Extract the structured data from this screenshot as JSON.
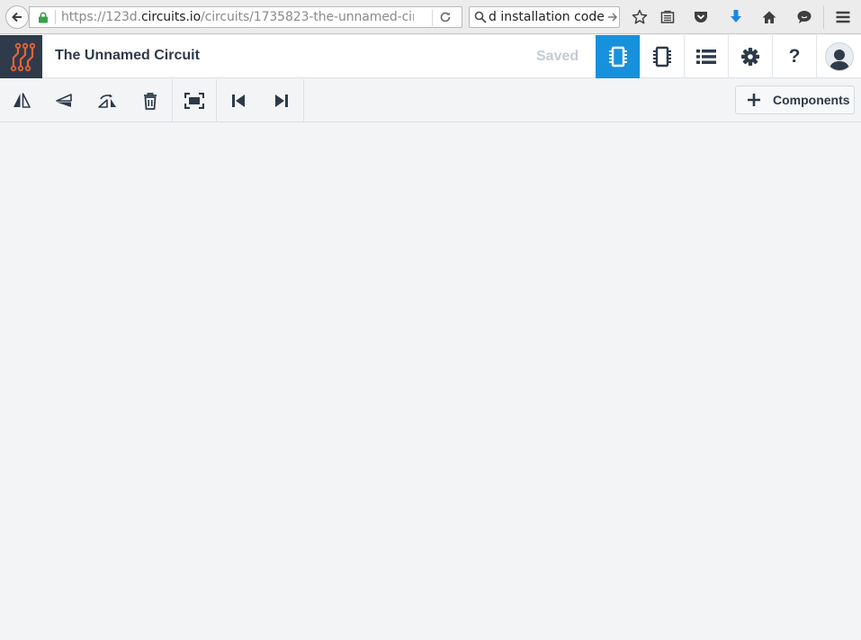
{
  "browser": {
    "url_prefix": "https://123d.",
    "url_host": "circuits.io",
    "url_path": "/circuits/1735823-the-unnamed-circ",
    "search_text": "d installation code",
    "icons": [
      "back-arrow-icon",
      "lock-icon",
      "reload-icon",
      "search-icon",
      "arrow-right-icon",
      "star-icon",
      "reading-list-icon",
      "pocket-icon",
      "download-icon",
      "home-icon",
      "chat-icon",
      "menu-icon"
    ]
  },
  "header": {
    "title": "The Unnamed Circuit",
    "save_status": "Saved",
    "help_label": "?",
    "accent_color": "#1891dc",
    "logo_color": "#e8623a"
  },
  "toolbar": {
    "tools": [
      "flip-horizontal",
      "flip-vertical",
      "rotate",
      "delete",
      "zoom-fit",
      "step-back",
      "step-forward"
    ],
    "components_label": "Components"
  }
}
